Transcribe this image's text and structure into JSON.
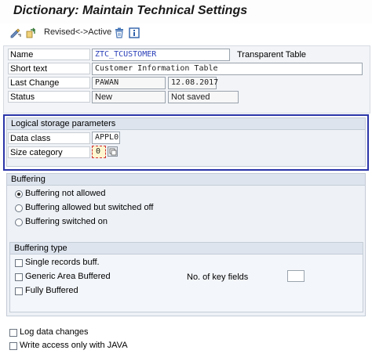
{
  "window": {
    "title": "Dictionary: Maintain Technical Settings"
  },
  "toolbar": {
    "toggle_label": "Revised<->Active"
  },
  "header": {
    "name_label": "Name",
    "name_value": "ZTC_TCUSTOMER",
    "table_type": "Transparent Table",
    "short_text_label": "Short text",
    "short_text_value": "Customer Information Table",
    "last_change_label": "Last Change",
    "last_change_user": "PAWAN",
    "last_change_date": "12.08.2017",
    "status_label": "Status",
    "status_value": "New",
    "status_saved": "Not saved"
  },
  "logical_storage": {
    "title": "Logical storage parameters",
    "data_class_label": "Data class",
    "data_class_value": "APPL0",
    "size_category_label": "Size category",
    "size_category_value": "0"
  },
  "buffering": {
    "title": "Buffering",
    "options": [
      "Buffering not allowed",
      "Buffering allowed but switched off",
      "Buffering switched on"
    ],
    "selected_index": 0
  },
  "buffering_type": {
    "title": "Buffering type",
    "single": "Single records buff.",
    "generic": "Generic Area Buffered",
    "full": "Fully Buffered",
    "key_fields_label": "No. of key fields",
    "key_fields_value": ""
  },
  "footer": {
    "log_changes": "Log data changes",
    "write_java": "Write access only with JAVA"
  }
}
